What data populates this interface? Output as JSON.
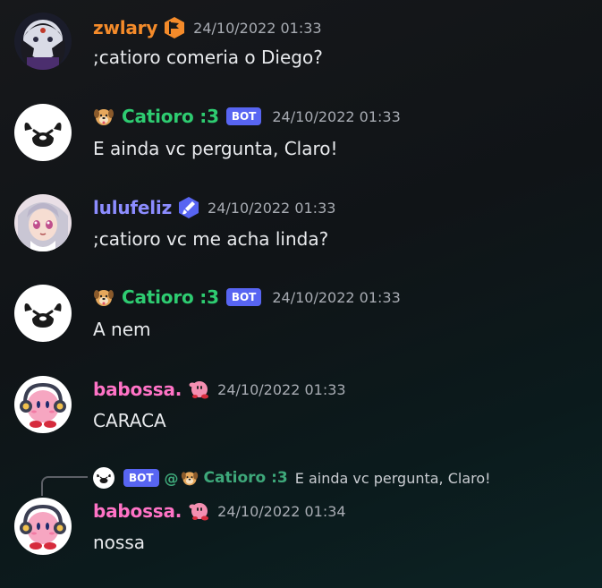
{
  "colors": {
    "zwlary": "#f58b2a",
    "catioro": "#2ecc71",
    "lulufeliz": "#8c8cff",
    "babossa": "#ff73c6",
    "bot_badge": "#5865f2",
    "mention": "#3ea87a"
  },
  "messages": [
    {
      "author": "zwlary",
      "timestamp": "24/10/2022 01:33",
      "text": ";catioro comeria o Diego?",
      "role_icon": "flag-icon"
    },
    {
      "author": "Catioro :3",
      "timestamp": "24/10/2022 01:33",
      "text": "E ainda vc pergunta, Claro!",
      "badge": "BOT",
      "emoji": "dog-face-icon"
    },
    {
      "author": "lulufeliz",
      "timestamp": "24/10/2022 01:33",
      "text": ";catioro vc me acha linda?",
      "role_icon": "brush-icon"
    },
    {
      "author": "Catioro :3",
      "timestamp": "24/10/2022 01:33",
      "text": "A nem",
      "badge": "BOT",
      "emoji": "dog-face-icon"
    },
    {
      "author": "babossa.",
      "timestamp": "24/10/2022 01:33",
      "text": "CARACA",
      "role_icon": "kirby-icon"
    },
    {
      "author": "babossa.",
      "timestamp": "24/10/2022 01:34",
      "text": "nossa",
      "role_icon": "kirby-icon"
    }
  ],
  "reply": {
    "badge": "BOT",
    "at": "@",
    "author": "Catioro :3",
    "text": "E ainda vc pergunta, Claro!"
  }
}
